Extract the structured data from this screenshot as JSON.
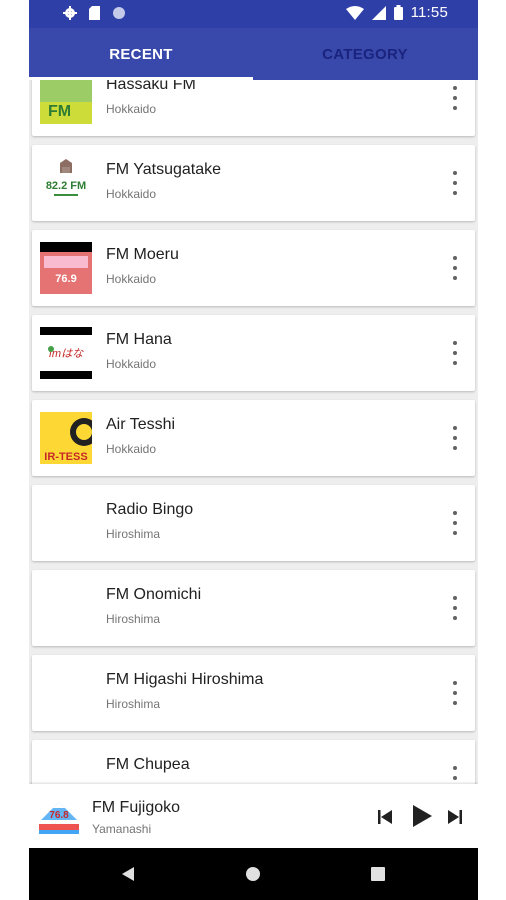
{
  "status_bar": {
    "time": "11:55",
    "icons": [
      "gear-icon",
      "sd-card-icon",
      "circle-icon",
      "wifi-icon",
      "signal-icon",
      "battery-icon"
    ]
  },
  "tabs": [
    {
      "label": "RECENT",
      "selected": true
    },
    {
      "label": "CATEGORY",
      "selected": false
    }
  ],
  "stations": [
    {
      "name": "Hassaku FM",
      "region": "Hokkaido",
      "logo": "green-fm-logo"
    },
    {
      "name": "FM Yatsugatake",
      "region": "Hokkaido",
      "logo": "82.2 FM"
    },
    {
      "name": "FM Moeru",
      "region": "Hokkaido",
      "logo": "76.9"
    },
    {
      "name": "FM Hana",
      "region": "Hokkaido",
      "logo": "fmはな"
    },
    {
      "name": "Air Tesshi",
      "region": "Hokkaido",
      "logo": "IR-TESS"
    },
    {
      "name": "Radio Bingo",
      "region": "Hiroshima",
      "logo": ""
    },
    {
      "name": "FM Onomichi",
      "region": "Hiroshima",
      "logo": ""
    },
    {
      "name": "FM Higashi Hiroshima",
      "region": "Hiroshima",
      "logo": ""
    },
    {
      "name": "FM Chupea",
      "region": "",
      "logo": ""
    }
  ],
  "player": {
    "name": "FM Fujigoko",
    "region": "Yamanashi",
    "logo": "76.8"
  },
  "colors": {
    "status_bar": "#2f3fa8",
    "app_bar": "#3949ab",
    "tab_inactive": "#1a237e",
    "background": "#eeeeee"
  }
}
